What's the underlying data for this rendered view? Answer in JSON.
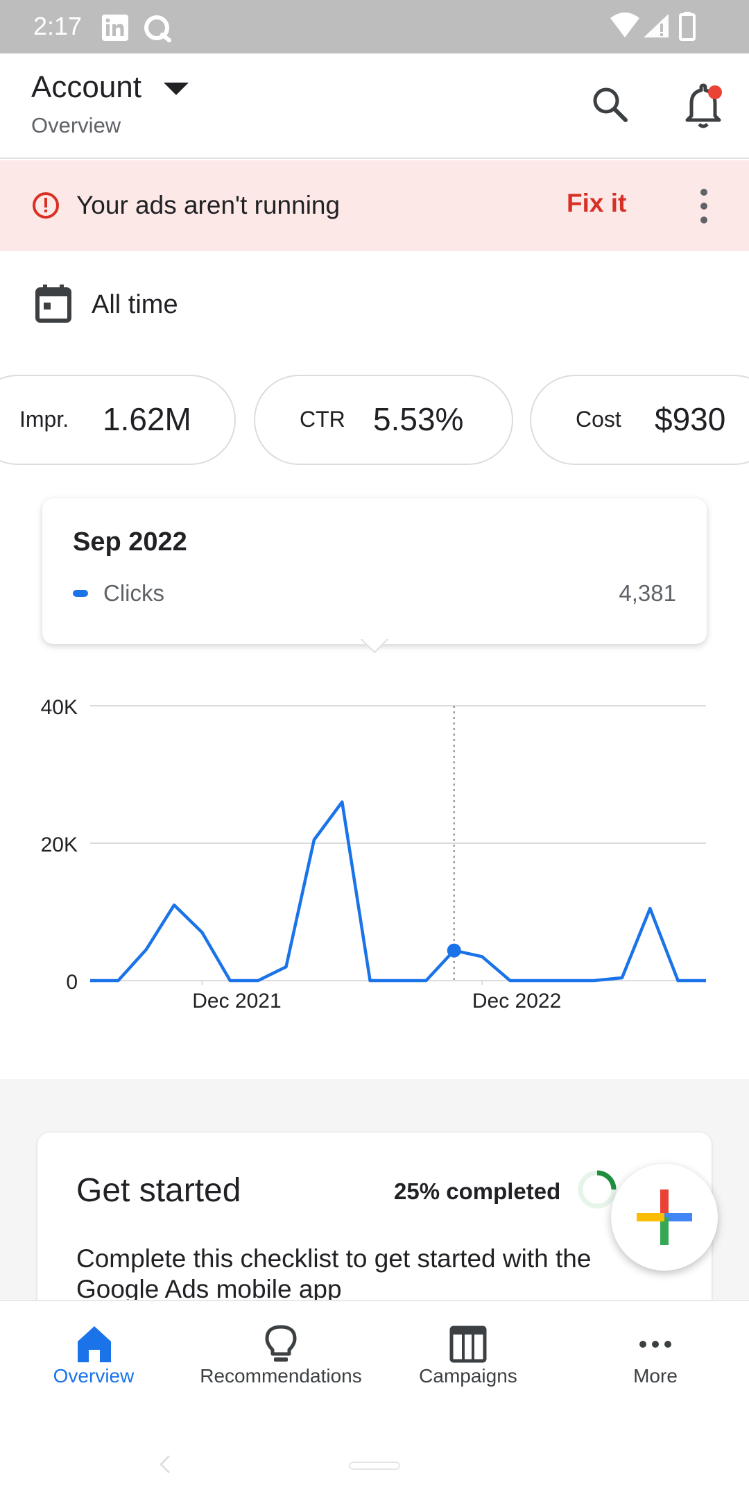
{
  "status_bar": {
    "time": "2:17",
    "left_icons": [
      "linkedin-icon",
      "chat-icon"
    ],
    "right_icons": [
      "wifi-icon",
      "signal-icon",
      "battery-icon"
    ]
  },
  "header": {
    "title": "Account",
    "subtitle": "Overview",
    "has_notification_dot": true
  },
  "alert": {
    "message": "Your ads aren't running",
    "action": "Fix it",
    "colors": {
      "background": "#fce8e6",
      "accent": "#d93025"
    }
  },
  "date_range": {
    "label": "All time"
  },
  "metrics": [
    {
      "label": "Impr.",
      "value": "1.62M"
    },
    {
      "label": "CTR",
      "value": "5.53%"
    },
    {
      "label": "Cost",
      "value": "$930"
    }
  ],
  "tooltip": {
    "period": "Sep 2022",
    "series": "Clicks",
    "value": "4,381"
  },
  "chart_data": {
    "type": "line",
    "series": [
      {
        "name": "Clicks",
        "color": "#1a73e8",
        "values": [
          0,
          0,
          4500,
          11000,
          7000,
          0,
          0,
          2000,
          20500,
          26000,
          0,
          0,
          0,
          4381,
          3500,
          0,
          0,
          0,
          0,
          400,
          10500,
          0,
          0
        ]
      }
    ],
    "x_ticks": [
      "Dec 2021",
      "Dec 2022"
    ],
    "y_ticks": [
      "0",
      "20K",
      "40K"
    ],
    "ylim": [
      0,
      40000
    ],
    "highlight_index": 13,
    "grid": true
  },
  "get_started": {
    "title": "Get started",
    "progress_text": "25% completed",
    "progress": 0.25,
    "description": "Complete this checklist to get started with the Google Ads mobile app"
  },
  "bottom_nav": {
    "items": [
      {
        "label": "Overview",
        "icon": "home-icon",
        "active": true
      },
      {
        "label": "Recommendations",
        "icon": "lightbulb-icon",
        "active": false
      },
      {
        "label": "Campaigns",
        "icon": "campaigns-icon",
        "active": false
      },
      {
        "label": "More",
        "icon": "more-icon",
        "active": false
      }
    ]
  }
}
